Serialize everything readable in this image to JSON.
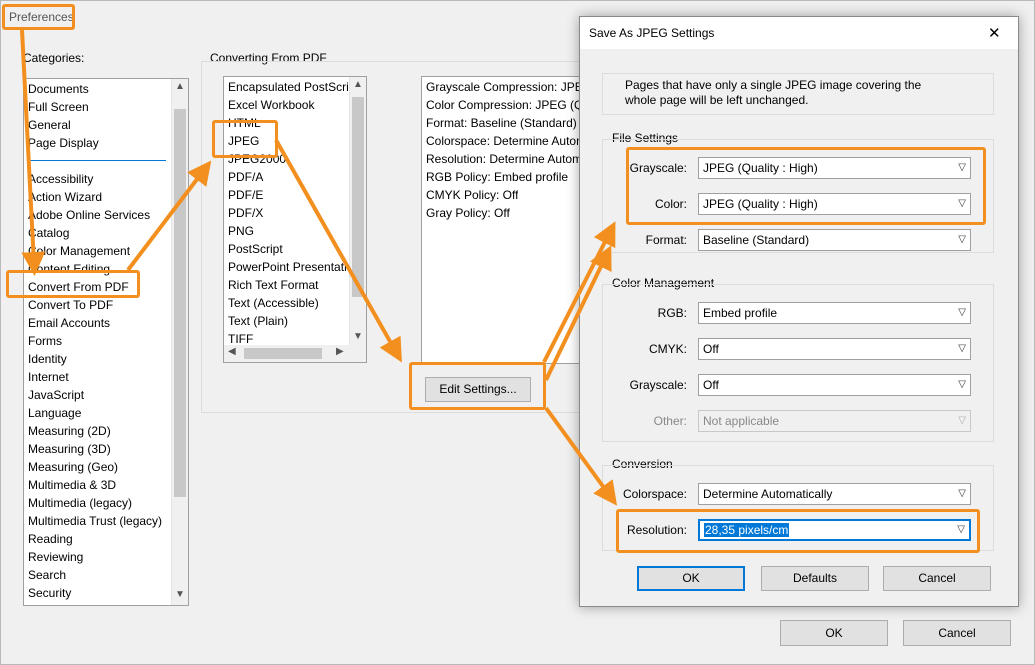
{
  "preferences": {
    "title": "Preferences",
    "categories_label": "Categories:",
    "categories_top": [
      "Documents",
      "Full Screen",
      "General",
      "Page Display"
    ],
    "categories": [
      "Accessibility",
      "Action Wizard",
      "Adobe Online Services",
      "Catalog",
      "Color Management",
      "Content Editing",
      "Convert From PDF",
      "Convert To PDF",
      "Email Accounts",
      "Forms",
      "Identity",
      "Internet",
      "JavaScript",
      "Language",
      "Measuring (2D)",
      "Measuring (3D)",
      "Measuring (Geo)",
      "Multimedia & 3D",
      "Multimedia (legacy)",
      "Multimedia Trust (legacy)",
      "Reading",
      "Reviewing",
      "Search",
      "Security"
    ],
    "selected_category": "Convert From PDF",
    "converting_from_label": "Converting From PDF",
    "formats": [
      "Encapsulated PostScript",
      "Excel Workbook",
      "HTML",
      "JPEG",
      "JPEG2000",
      "PDF/A",
      "PDF/E",
      "PDF/X",
      "PNG",
      "PostScript",
      "PowerPoint Presentation",
      "Rich Text Format",
      "Text (Accessible)",
      "Text (Plain)",
      "TIFF"
    ],
    "settings_summary": [
      "Grayscale Compression: JPEG",
      "Color Compression: JPEG (Qu",
      "Format: Baseline (Standard)",
      "Colorspace: Determine Autom",
      "Resolution: Determine Autom",
      "RGB Policy: Embed profile",
      "CMYK Policy: Off",
      "Gray Policy: Off"
    ],
    "edit_settings_label": "Edit Settings...",
    "ok_label": "OK",
    "cancel_label": "Cancel"
  },
  "jpeg_dialog": {
    "title": "Save As JPEG Settings",
    "close_glyph": "✕",
    "info_text": "Pages that have only a single JPEG image covering the whole page will be left unchanged.",
    "file_settings_label": "File Settings",
    "grayscale_label": "Grayscale:",
    "grayscale_value": "JPEG (Quality : High)",
    "color_label": "Color:",
    "color_value": "JPEG (Quality : High)",
    "format_label": "Format:",
    "format_value": "Baseline (Standard)",
    "color_management_label": "Color Management",
    "rgb_label": "RGB:",
    "rgb_value": "Embed profile",
    "cmyk_label": "CMYK:",
    "cmyk_value": "Off",
    "cm_grayscale_label": "Grayscale:",
    "cm_grayscale_value": "Off",
    "other_label": "Other:",
    "other_value": "Not applicable",
    "conversion_label": "Conversion",
    "colorspace_label": "Colorspace:",
    "colorspace_value": "Determine Automatically",
    "resolution_label": "Resolution:",
    "resolution_value": "28,35 pixels/cm",
    "ok_label": "OK",
    "defaults_label": "Defaults",
    "cancel_label": "Cancel"
  },
  "colors": {
    "highlight": "#f28f1e",
    "selection": "#0078d7",
    "accent_line": "#0078d7"
  },
  "icons": {
    "dropdown": "chevron-down-icon",
    "close": "close-icon"
  }
}
